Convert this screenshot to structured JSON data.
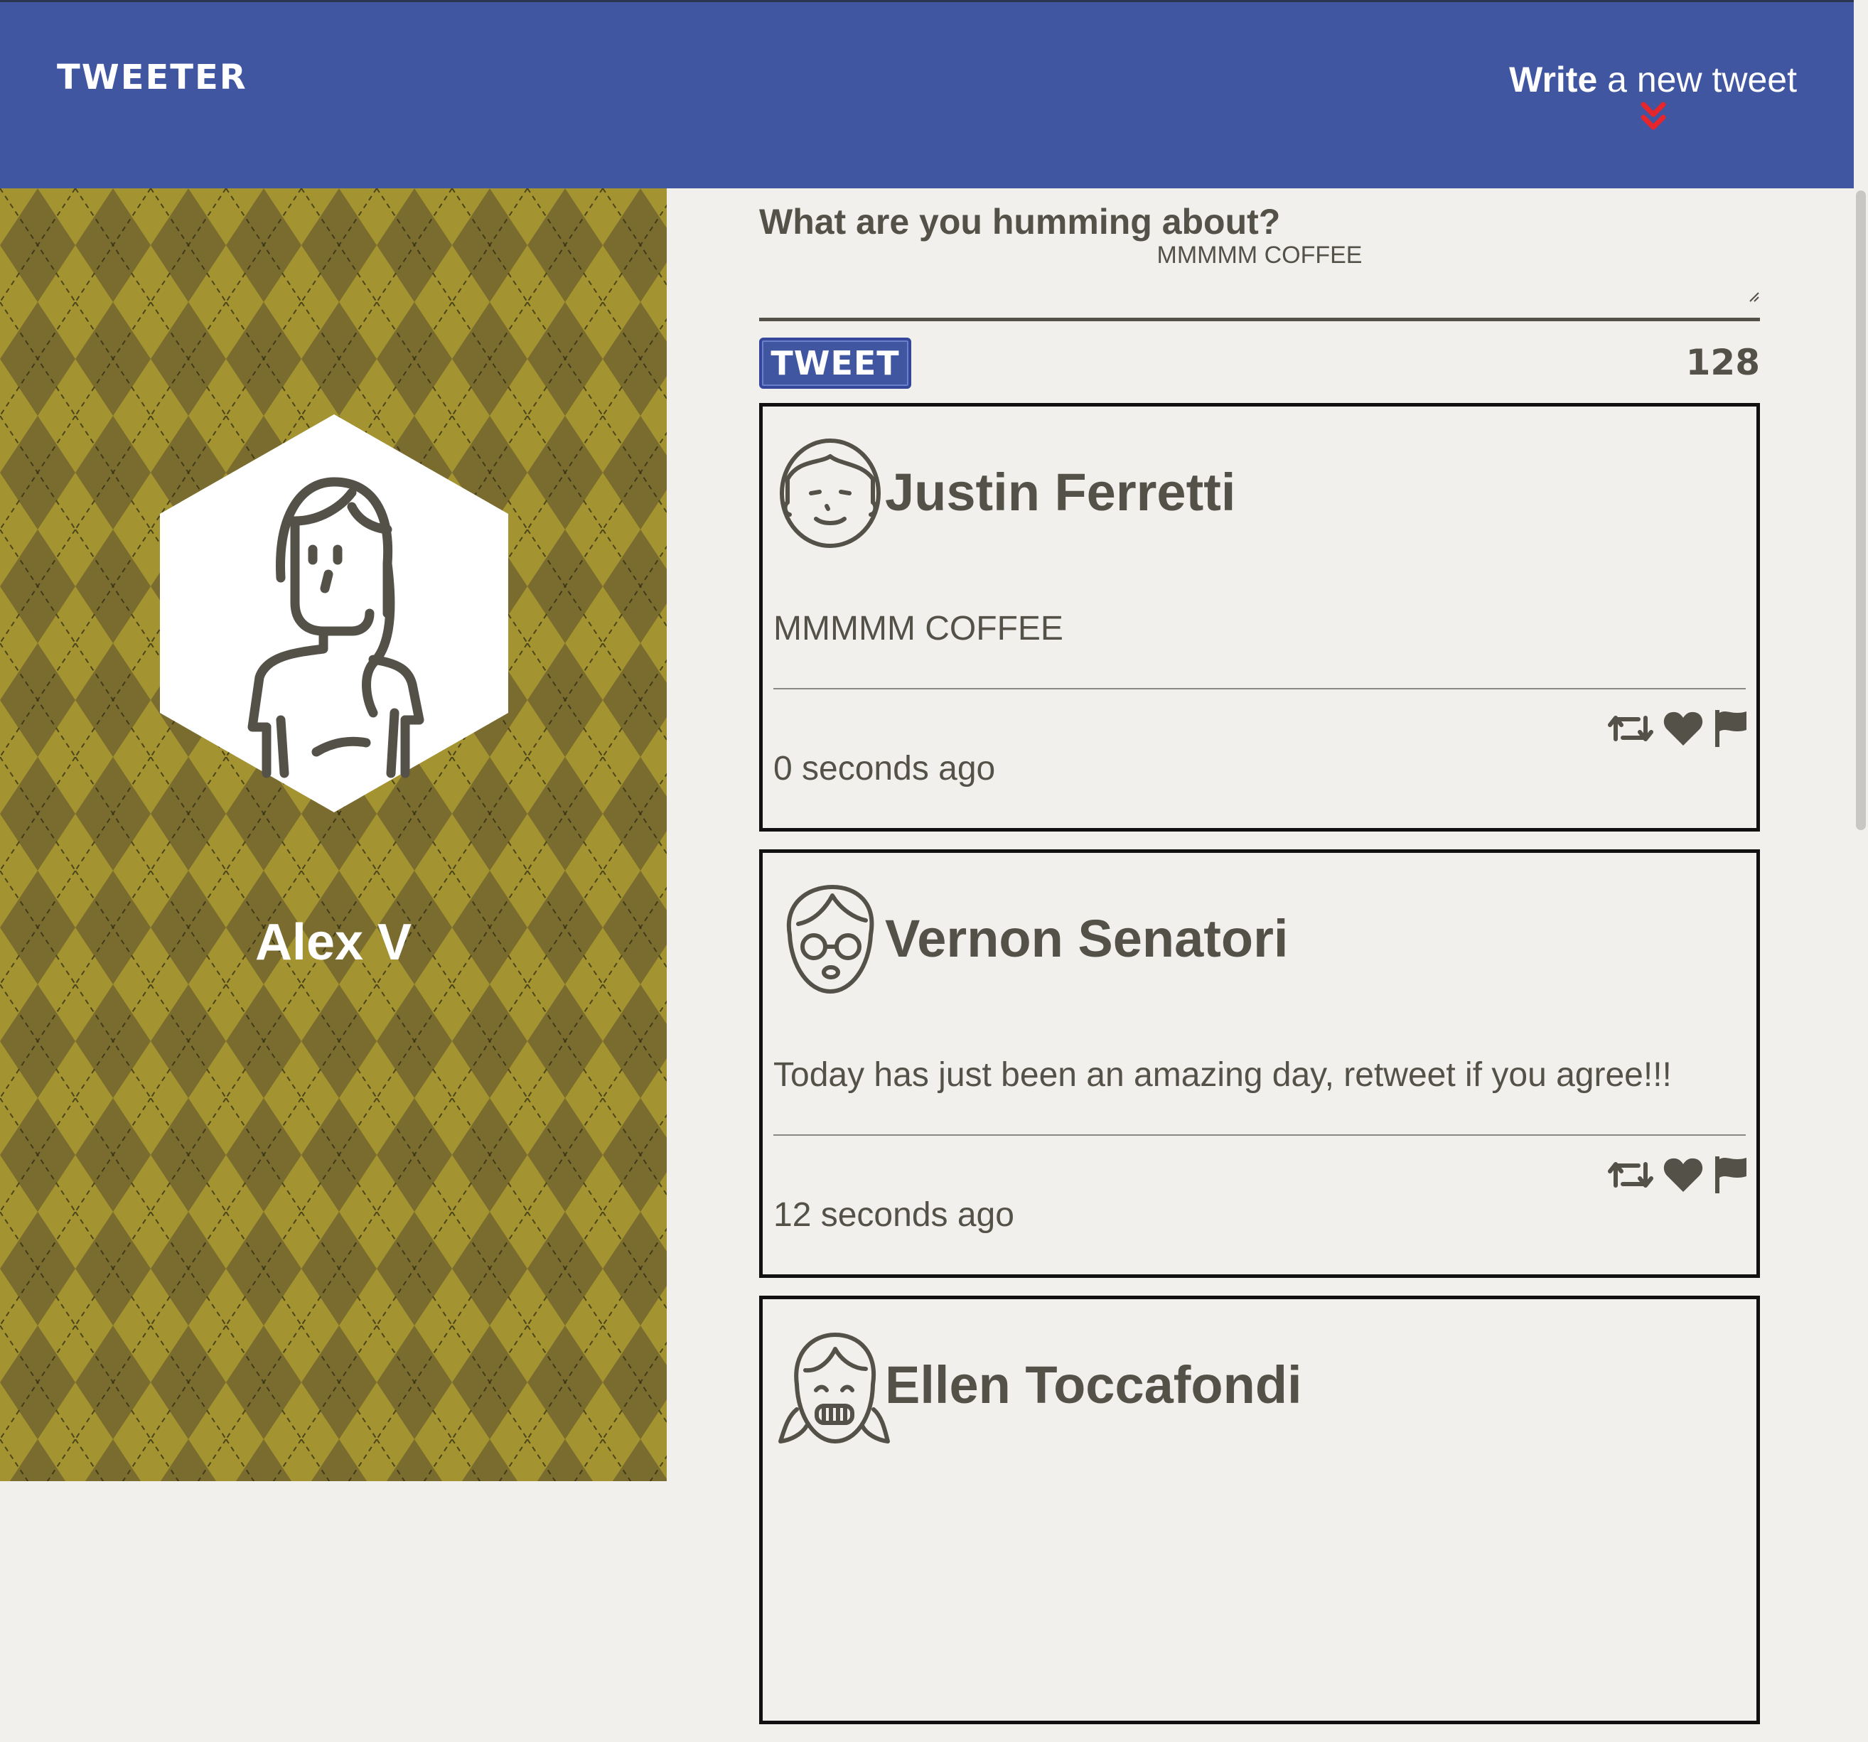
{
  "nav": {
    "brand": "TWEETER",
    "compose_strong": "Write",
    "compose_rest": " a new tweet"
  },
  "profile": {
    "name": "Alex V"
  },
  "compose": {
    "label": "What are you humming about?",
    "text": "MMMMM COFFEE",
    "button_label": "TWEET",
    "counter": "128"
  },
  "tweets": [
    {
      "name": "Justin Ferretti",
      "content": "MMMMM COFFEE",
      "time": "0 seconds ago",
      "avatar": "man-avatar-icon"
    },
    {
      "name": "Vernon Senatori",
      "content": "Today has just been an amazing day, retweet if you agree!!!",
      "time": "12 seconds ago",
      "avatar": "glasses-avatar-icon"
    },
    {
      "name": "Ellen Toccafondi",
      "content": "",
      "time": "",
      "avatar": "pigtails-girl-avatar-icon"
    }
  ],
  "colors": {
    "nav_bg": "#4056a1",
    "page_bg": "#f2f0ec",
    "text": "#545149",
    "argyle_dark": "#7a6c2e",
    "argyle_light": "#a39331",
    "chevron": "#e6262a"
  }
}
